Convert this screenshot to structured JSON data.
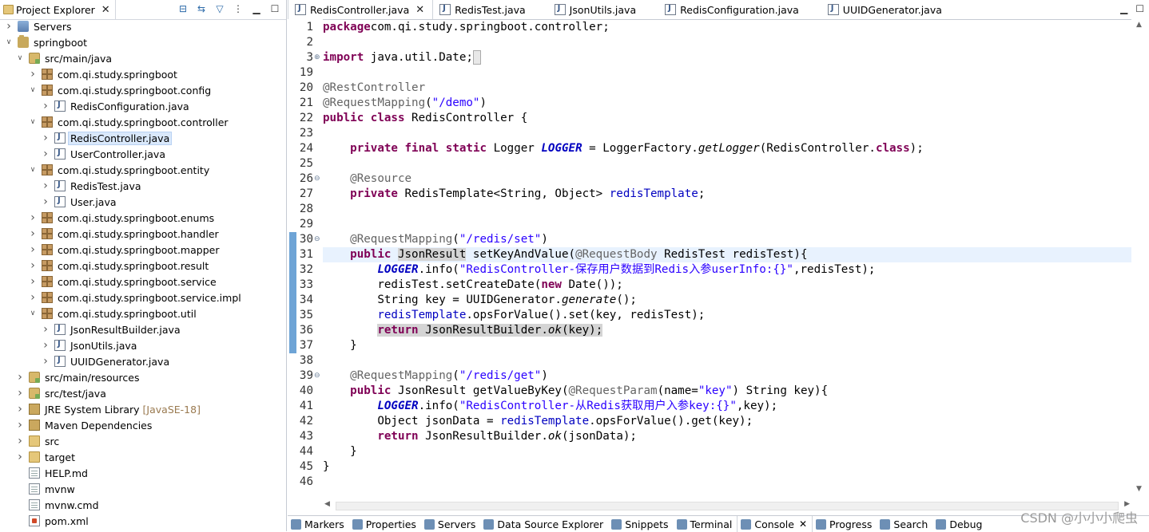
{
  "explorer": {
    "title": "Project Explorer",
    "close": "✕",
    "tree": [
      {
        "label": "Servers",
        "icon": "servers",
        "level": 0,
        "chev": ">"
      },
      {
        "label": "springboot",
        "icon": "project",
        "level": 0,
        "chev": "v"
      },
      {
        "label": "src/main/java",
        "icon": "srcfolder",
        "level": 1,
        "chev": "v"
      },
      {
        "label": "com.qi.study.springboot",
        "icon": "pkg",
        "level": 2,
        "chev": ">"
      },
      {
        "label": "com.qi.study.springboot.config",
        "icon": "pkg",
        "level": 2,
        "chev": "v"
      },
      {
        "label": "RedisConfiguration.java",
        "icon": "java",
        "level": 3,
        "chev": ">"
      },
      {
        "label": "com.qi.study.springboot.controller",
        "icon": "pkg",
        "level": 2,
        "chev": "v"
      },
      {
        "label": "RedisController.java",
        "icon": "java",
        "level": 3,
        "chev": ">",
        "selected": true
      },
      {
        "label": "UserController.java",
        "icon": "java",
        "level": 3,
        "chev": ">"
      },
      {
        "label": "com.qi.study.springboot.entity",
        "icon": "pkg",
        "level": 2,
        "chev": "v"
      },
      {
        "label": "RedisTest.java",
        "icon": "java",
        "level": 3,
        "chev": ">"
      },
      {
        "label": "User.java",
        "icon": "java",
        "level": 3,
        "chev": ">"
      },
      {
        "label": "com.qi.study.springboot.enums",
        "icon": "pkg",
        "level": 2,
        "chev": ">"
      },
      {
        "label": "com.qi.study.springboot.handler",
        "icon": "pkg",
        "level": 2,
        "chev": ">"
      },
      {
        "label": "com.qi.study.springboot.mapper",
        "icon": "pkg",
        "level": 2,
        "chev": ">"
      },
      {
        "label": "com.qi.study.springboot.result",
        "icon": "pkg",
        "level": 2,
        "chev": ">"
      },
      {
        "label": "com.qi.study.springboot.service",
        "icon": "pkg",
        "level": 2,
        "chev": ">"
      },
      {
        "label": "com.qi.study.springboot.service.impl",
        "icon": "pkg",
        "level": 2,
        "chev": ">"
      },
      {
        "label": "com.qi.study.springboot.util",
        "icon": "pkg",
        "level": 2,
        "chev": "v"
      },
      {
        "label": "JsonResultBuilder.java",
        "icon": "java",
        "level": 3,
        "chev": ">"
      },
      {
        "label": "JsonUtils.java",
        "icon": "java",
        "level": 3,
        "chev": ">"
      },
      {
        "label": "UUIDGenerator.java",
        "icon": "java",
        "level": 3,
        "chev": ">"
      },
      {
        "label": "src/main/resources",
        "icon": "srcfolder",
        "level": 1,
        "chev": ">"
      },
      {
        "label": "src/test/java",
        "icon": "srcfolder",
        "level": 1,
        "chev": ">"
      },
      {
        "label": "JRE System Library",
        "icon": "lib",
        "level": 1,
        "chev": ">",
        "decoration": "[JavaSE-18]"
      },
      {
        "label": "Maven Dependencies",
        "icon": "lib",
        "level": 1,
        "chev": ">"
      },
      {
        "label": "src",
        "icon": "folder",
        "level": 1,
        "chev": ">"
      },
      {
        "label": "target",
        "icon": "folder",
        "level": 1,
        "chev": ">"
      },
      {
        "label": "HELP.md",
        "icon": "file",
        "level": 1,
        "chev": ""
      },
      {
        "label": "mvnw",
        "icon": "file",
        "level": 1,
        "chev": ""
      },
      {
        "label": "mvnw.cmd",
        "icon": "file",
        "level": 1,
        "chev": ""
      },
      {
        "label": "pom.xml",
        "icon": "xml",
        "level": 1,
        "chev": ""
      }
    ]
  },
  "editor": {
    "tabs": [
      {
        "label": "RedisController.java",
        "active": true,
        "close": "✕"
      },
      {
        "label": "RedisTest.java"
      },
      {
        "label": "JsonUtils.java"
      },
      {
        "label": "RedisConfiguration.java"
      },
      {
        "label": "UUIDGenerator.java"
      }
    ],
    "lines": [
      {
        "n": "1",
        "fold": "",
        "tokens": [
          [
            "kw",
            "package"
          ],
          [
            "",
            "com.qi.study.springboot.controller;"
          ]
        ]
      },
      {
        "n": "2",
        "fold": "",
        "tokens": []
      },
      {
        "n": "3",
        "fold": "⊕",
        "tokens": [
          [
            "kw",
            "import"
          ],
          [
            "",
            " java.util.Date;"
          ],
          [
            "hlbox",
            " "
          ]
        ]
      },
      {
        "n": "19",
        "fold": "",
        "tokens": []
      },
      {
        "n": "20",
        "fold": "",
        "tokens": [
          [
            "ann",
            "@RestController"
          ]
        ]
      },
      {
        "n": "21",
        "fold": "",
        "tokens": [
          [
            "ann",
            "@RequestMapping"
          ],
          [
            "",
            "("
          ],
          [
            "str",
            "\"/demo\""
          ],
          [
            "",
            ")"
          ]
        ]
      },
      {
        "n": "22",
        "fold": "",
        "tokens": [
          [
            "kw",
            "public"
          ],
          [
            "",
            " "
          ],
          [
            "kw",
            "class"
          ],
          [
            "",
            " RedisController {"
          ]
        ]
      },
      {
        "n": "23",
        "fold": "",
        "tokens": []
      },
      {
        "n": "24",
        "fold": "",
        "tokens": [
          [
            "",
            "    "
          ],
          [
            "kw",
            "private"
          ],
          [
            "",
            " "
          ],
          [
            "kw",
            "final"
          ],
          [
            "",
            " "
          ],
          [
            "kw",
            "static"
          ],
          [
            "",
            " Logger "
          ],
          [
            "sfld",
            "LOGGER"
          ],
          [
            "",
            " = LoggerFactory."
          ],
          [
            "it",
            "getLogger"
          ],
          [
            "",
            "(RedisController."
          ],
          [
            "kw",
            "class"
          ],
          [
            "",
            ");"
          ]
        ]
      },
      {
        "n": "25",
        "fold": "",
        "tokens": []
      },
      {
        "n": "26",
        "fold": "⊖",
        "tokens": [
          [
            "",
            "    "
          ],
          [
            "ann",
            "@Resource"
          ]
        ]
      },
      {
        "n": "27",
        "fold": "",
        "tokens": [
          [
            "",
            "    "
          ],
          [
            "kw",
            "private"
          ],
          [
            "",
            " RedisTemplate<String, Object> "
          ],
          [
            "fld",
            "redisTemplate"
          ],
          [
            "",
            ";"
          ]
        ]
      },
      {
        "n": "28",
        "fold": "",
        "tokens": []
      },
      {
        "n": "29",
        "fold": "",
        "tokens": []
      },
      {
        "n": "30",
        "fold": "⊖",
        "tokens": [
          [
            "",
            "    "
          ],
          [
            "ann",
            "@RequestMapping"
          ],
          [
            "",
            "("
          ],
          [
            "str",
            "\"/redis/set\""
          ],
          [
            "",
            ")"
          ]
        ]
      },
      {
        "n": "31",
        "fold": "",
        "current": true,
        "tokens": [
          [
            "",
            "    "
          ],
          [
            "kw",
            "public"
          ],
          [
            "",
            " "
          ],
          [
            "hl",
            "JsonResult"
          ],
          [
            "",
            " setKeyAndValue("
          ],
          [
            "ann",
            "@RequestBody"
          ],
          [
            "",
            " RedisTest "
          ],
          [
            "",
            "redisTest"
          ],
          [
            "",
            "){"
          ]
        ]
      },
      {
        "n": "32",
        "fold": "",
        "tokens": [
          [
            "",
            "        "
          ],
          [
            "sfld",
            "LOGGER"
          ],
          [
            "",
            ".info("
          ],
          [
            "str",
            "\"RedisController-保存用户数据到Redis入参userInfo:{}\""
          ],
          [
            "",
            ",redisTest);"
          ]
        ]
      },
      {
        "n": "33",
        "fold": "",
        "tokens": [
          [
            "",
            "        redisTest.setCreateDate("
          ],
          [
            "kw",
            "new"
          ],
          [
            "",
            " Date());"
          ]
        ]
      },
      {
        "n": "34",
        "fold": "",
        "tokens": [
          [
            "",
            "        String key = UUIDGenerator."
          ],
          [
            "it",
            "generate"
          ],
          [
            "",
            "();"
          ]
        ]
      },
      {
        "n": "35",
        "fold": "",
        "tokens": [
          [
            "",
            "        "
          ],
          [
            "fld",
            "redisTemplate"
          ],
          [
            "",
            ".opsForValue().set(key, redisTest);"
          ]
        ]
      },
      {
        "n": "36",
        "fold": "",
        "tokens": [
          [
            "",
            "        "
          ],
          [
            "hl",
            ""
          ],
          [
            "kw",
            "return"
          ],
          [
            "hl",
            " JsonResultBuilder."
          ],
          [
            "hlit",
            "ok"
          ],
          [
            "hl",
            "(key);"
          ]
        ]
      },
      {
        "n": "37",
        "fold": "",
        "tokens": [
          [
            "",
            "    }"
          ]
        ]
      },
      {
        "n": "38",
        "fold": "",
        "tokens": []
      },
      {
        "n": "39",
        "fold": "⊖",
        "tokens": [
          [
            "",
            "    "
          ],
          [
            "ann",
            "@RequestMapping"
          ],
          [
            "",
            "("
          ],
          [
            "str",
            "\"/redis/get\""
          ],
          [
            "",
            ")"
          ]
        ]
      },
      {
        "n": "40",
        "fold": "",
        "tokens": [
          [
            "",
            "    "
          ],
          [
            "kw",
            "public"
          ],
          [
            "",
            " JsonResult getValueByKey("
          ],
          [
            "ann",
            "@RequestParam"
          ],
          [
            "",
            "(name="
          ],
          [
            "str",
            "\"key\""
          ],
          [
            "",
            ") String key){"
          ]
        ]
      },
      {
        "n": "41",
        "fold": "",
        "tokens": [
          [
            "",
            "        "
          ],
          [
            "sfld",
            "LOGGER"
          ],
          [
            "",
            ".info("
          ],
          [
            "str",
            "\"RedisController-从Redis获取用户入参key:{}\""
          ],
          [
            "",
            ",key);"
          ]
        ]
      },
      {
        "n": "42",
        "fold": "",
        "tokens": [
          [
            "",
            "        Object jsonData = "
          ],
          [
            "fld",
            "redisTemplate"
          ],
          [
            "",
            ".opsForValue().get(key);"
          ]
        ]
      },
      {
        "n": "43",
        "fold": "",
        "tokens": [
          [
            "",
            "        "
          ],
          [
            "kw",
            "return"
          ],
          [
            "",
            " JsonResultBuilder."
          ],
          [
            "it",
            "ok"
          ],
          [
            "",
            "(jsonData);"
          ]
        ]
      },
      {
        "n": "44",
        "fold": "",
        "tokens": [
          [
            "",
            "    }"
          ]
        ]
      },
      {
        "n": "45",
        "fold": "",
        "tokens": [
          [
            "",
            "}"
          ]
        ]
      },
      {
        "n": "46",
        "fold": "",
        "tokens": []
      }
    ]
  },
  "bottom_tabs": [
    {
      "label": "Markers"
    },
    {
      "label": "Properties"
    },
    {
      "label": "Servers"
    },
    {
      "label": "Data Source Explorer"
    },
    {
      "label": "Snippets"
    },
    {
      "label": "Terminal"
    },
    {
      "label": "Console",
      "active": true,
      "close": "✕"
    },
    {
      "label": "Progress"
    },
    {
      "label": "Search"
    },
    {
      "label": "Debug"
    }
  ],
  "watermark": "CSDN @小小小爬虫",
  "colors": {
    "keyword": "#7f0055",
    "string": "#2a00ff",
    "annotation": "#646464",
    "field": "#0000c0",
    "current_line": "#e8f2fe",
    "selection": "#d9e8fb"
  }
}
